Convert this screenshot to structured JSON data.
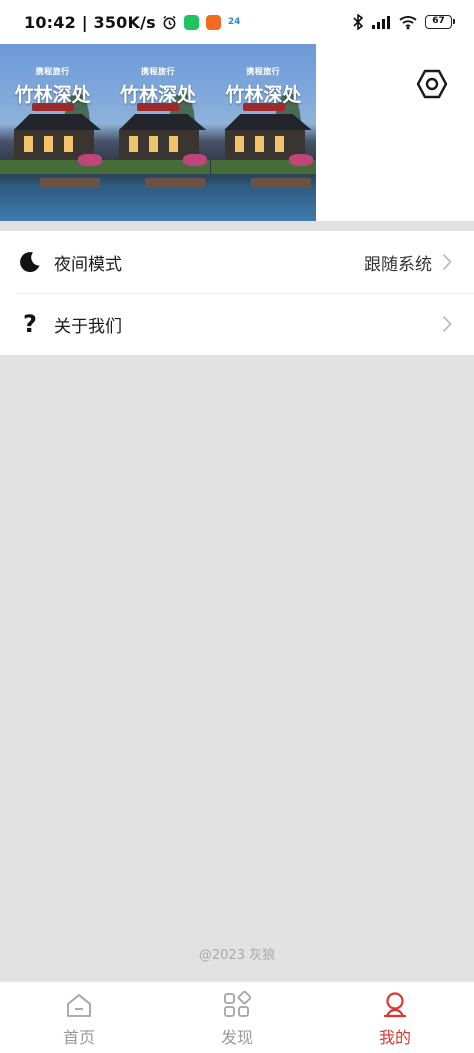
{
  "status_bar": {
    "time": "10:42 | 350K/s",
    "calendar_day": "24",
    "battery": "67"
  },
  "banner": {
    "brand": "携程旅行",
    "headline": "竹林深处"
  },
  "menu": {
    "items": [
      {
        "label": "夜间模式",
        "value": "跟随系统",
        "icon": "moon-icon"
      },
      {
        "label": "关于我们",
        "value": "",
        "icon": "question-icon"
      }
    ]
  },
  "footer": {
    "copyright": "@2023 灰狼"
  },
  "tabbar": {
    "tabs": [
      {
        "label": "首页",
        "icon": "home-icon",
        "active": false
      },
      {
        "label": "发现",
        "icon": "discover-icon",
        "active": false
      },
      {
        "label": "我的",
        "icon": "profile-icon",
        "active": true
      }
    ]
  },
  "colors": {
    "accent": "#d63a32",
    "background": "#e2e2e2",
    "surface": "#ffffff",
    "inactive": "#9a9a9a"
  }
}
